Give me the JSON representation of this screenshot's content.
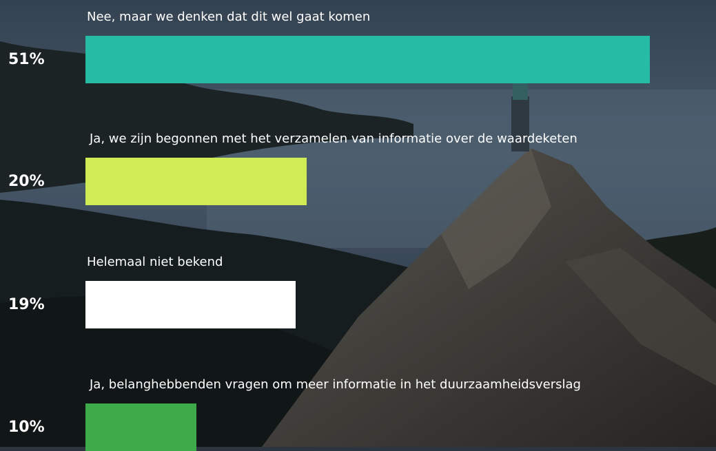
{
  "chart_data": {
    "type": "bar",
    "orientation": "horizontal",
    "categories": [
      "Nee, maar we denken dat dit wel gaat komen",
      "Ja, we zijn begonnen met het verzamelen van informatie over de waardeketen",
      "Helemaal niet bekend",
      "Ja, belanghebbenden vragen om meer informatie in het duurzaamheidsverslag"
    ],
    "values": [
      51,
      20,
      19,
      10
    ],
    "value_labels": [
      "51%",
      "20%",
      "19%",
      "10%"
    ],
    "colors": [
      "#26bba4",
      "#d0ec55",
      "#ffffff",
      "#3eab4a"
    ],
    "xlim": [
      0,
      51
    ],
    "grid": false,
    "legend": "none"
  },
  "background": {
    "description_icon": "mountain-landscape-photo",
    "colors": [
      "#5f7890",
      "#3a4a5a",
      "#1f2a30",
      "#4a4540"
    ]
  }
}
